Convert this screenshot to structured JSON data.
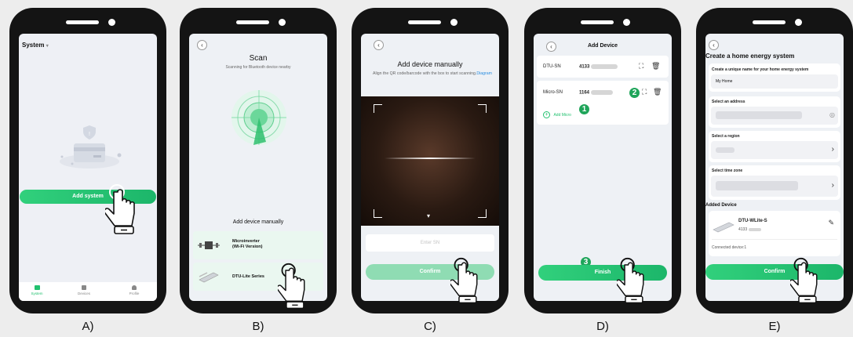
{
  "a": {
    "caption": "A)",
    "header": "System",
    "add_button": "Add system",
    "nav": [
      "System",
      "Devices",
      "Profile"
    ]
  },
  "b": {
    "caption": "B)",
    "title": "Scan",
    "subtitle": "Scanning for Bluetooth device nearby",
    "manual": "Add device manually",
    "items": [
      "Microinverter\n(Wi-Fi Version)",
      "DTU-Lite Series"
    ]
  },
  "c": {
    "caption": "C)",
    "title": "Add device manually",
    "instruction": "Align the QR code/barcode with the box to start scanning.",
    "diagram_link": "Diagram",
    "input_placeholder": "Enter SN",
    "confirm": "Confirm"
  },
  "d": {
    "caption": "D)",
    "title": "Add Device",
    "dtu_label": "DTU-SN",
    "dtu_value": "4133",
    "micro_label": "Micro-SN",
    "micro_value": "1164",
    "add_micro": "Add Micro",
    "finish": "Finish",
    "badges": [
      "1",
      "2",
      "3"
    ]
  },
  "e": {
    "caption": "E)",
    "title": "Create a home energy system",
    "name_label": "Create a unique name for your home energy system",
    "name_value": "My Home",
    "address_label": "Select an address",
    "region_label": "Select a region",
    "tz_label": "Select time zone",
    "added_device": "Added Device",
    "device_name": "DTU-WLite-S",
    "device_sn": "4133",
    "connected": "Connected device:1",
    "confirm": "Confirm"
  },
  "colors": {
    "accent": "#22c16f",
    "phone": "#141414",
    "background": "#ededed"
  }
}
